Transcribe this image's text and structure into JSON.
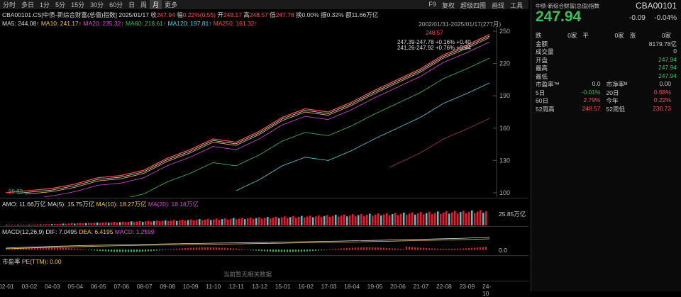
{
  "toolbar": {
    "tabs": [
      "分时",
      "多日",
      "1分",
      "5分",
      "15分",
      "30分",
      "60分",
      "日",
      "周",
      "月",
      "更多"
    ],
    "active": 9,
    "right": [
      "F9",
      "复权",
      "超级四图",
      "画线",
      "工具"
    ]
  },
  "info": {
    "code": "CBA00101.CS[中债-新综合财富(总值)指数]",
    "date": "2025/01/17",
    "close_l": "收",
    "close": "247.94",
    "chg_l": "幅",
    "chg": "0.22%(0.55)",
    "open_l": "开",
    "open": "248.17",
    "high_l": "高",
    "high": "248.57",
    "low_l": "低",
    "low": "247.78",
    "turn_l": "换",
    "turn": "0.00%",
    "amp_l": "振",
    "amp": "0.32%",
    "amt_l": "额",
    "amt": "11.66万亿"
  },
  "ma": {
    "ma5": "MA5: 244.08↑",
    "ma10": "MA10: 241.17↑",
    "ma20": "MA20: 235.32↑",
    "ma60": "MA60: 218.61↑",
    "ma120": "MA120: 197.81↑",
    "ma250": "MA250: 161.32↑",
    "range": "2002/01/31-2025/01/17(277月)"
  },
  "labels": {
    "top": "248.57",
    "t1": "247.39-247.78 +0.16% +0.40",
    "t2": "241.26-247.92 +0.76% +0.84",
    "low": "99.83"
  },
  "amo": {
    "a": "AMO: 11.66万亿",
    "b": "MA(5): 15.75万亿",
    "c": "MA(10): 18.27万亿",
    "d": "MA(20): 18.18万亿",
    "max": "25.85万亿"
  },
  "macd": {
    "name": "MACD(12,26,9)",
    "dif": "DIF: 7.0495",
    "dea": "DEA: 6.4195",
    "macd": "MACD: 1.2599",
    "zero": "0.0"
  },
  "pe": {
    "label": "市盈率",
    "val": "PE(TTM): 0.00",
    "empty": "当前暂无相关数据"
  },
  "chart_data": {
    "type": "line",
    "x": [
      "02-01",
      "03-02",
      "04-03",
      "05-04",
      "06-05",
      "07-06",
      "08-07",
      "09-08",
      "10-09",
      "11-10",
      "12-11",
      "13-12",
      "15-01",
      "16-02",
      "17-03",
      "18-04",
      "19-05",
      "20-06",
      "21-07",
      "22-08",
      "23-09",
      "24-10"
    ],
    "y": [
      100,
      102,
      104,
      108,
      114,
      116,
      121,
      132,
      140,
      150,
      147,
      157,
      170,
      178,
      175,
      184,
      195,
      205,
      215,
      228,
      237,
      247
    ],
    "yticks": [
      100,
      130,
      160,
      190,
      220,
      250
    ],
    "ylim": [
      98,
      252
    ]
  },
  "quote": {
    "title": "中债-新综合财富(总值)指数",
    "code": "CBA00101",
    "price": "247.94",
    "chg": "-0.09",
    "pct": "-0.04%",
    "rows": [
      [
        "跌",
        "0家",
        "平",
        "0家",
        "涨",
        "0家"
      ],
      [
        "金额",
        "8179.78亿"
      ],
      [
        "成交量",
        "0"
      ],
      [
        "开盘",
        "247.94"
      ],
      [
        "最高",
        "247.94"
      ],
      [
        "最低",
        "247.94"
      ],
      [
        "市盈率™",
        "0.0",
        "市净率ᴹ",
        "0.00"
      ],
      [
        "5日",
        "-0.01%",
        "20日",
        "0.68%"
      ],
      [
        "60日",
        "2.79%",
        "今年",
        "0.22%"
      ],
      [
        "52周高",
        "248.57",
        "52周低",
        "230.73"
      ]
    ]
  }
}
